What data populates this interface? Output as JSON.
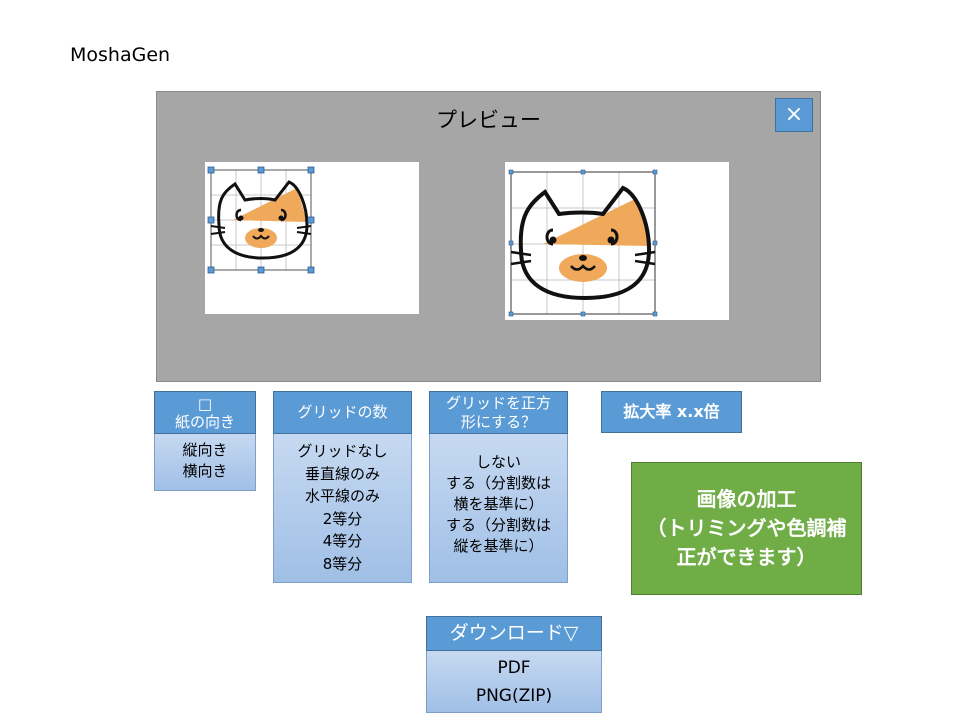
{
  "app": {
    "title": "MoshaGen"
  },
  "preview": {
    "title": "プレビュー",
    "close_icon": "×"
  },
  "paper": {
    "header_icon": "□",
    "header": "紙の向き",
    "options": [
      "縦向き",
      "横向き"
    ]
  },
  "grid_count": {
    "header": "グリッドの数",
    "options": [
      "グリッドなし",
      "垂直線のみ",
      "水平線のみ",
      "2等分",
      "4等分",
      "8等分"
    ]
  },
  "grid_square": {
    "header": [
      "グリッドを正方",
      "形にする？"
    ],
    "options": [
      [
        "しない"
      ],
      [
        "する（分割数は",
        "横を基準に）"
      ],
      [
        "する（分割数は",
        "縦を基準に）"
      ]
    ]
  },
  "zoom": {
    "label": "拡大率 x.x倍"
  },
  "edit": {
    "lines": [
      "画像の加工",
      "（トリミングや色調補",
      "正ができます）"
    ]
  },
  "download": {
    "header": "ダウンロード▽",
    "options": [
      "PDF",
      "PNG(ZIP)"
    ]
  },
  "colors": {
    "accent": "#5b9bd5",
    "green": "#70ad47",
    "preview_bg": "#a6a6a6",
    "cat_patch": "#f0a85a"
  }
}
